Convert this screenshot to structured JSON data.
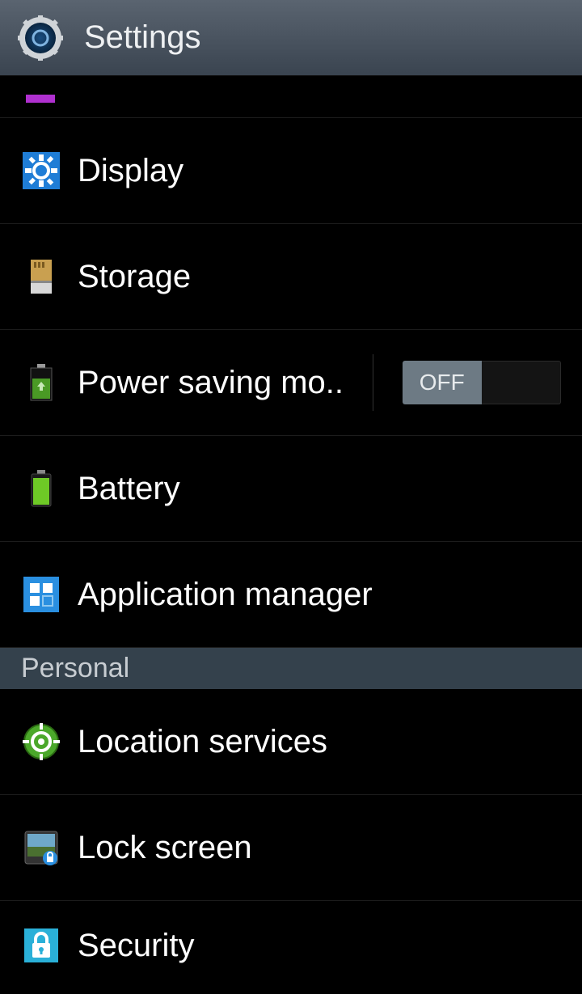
{
  "header": {
    "title": "Settings"
  },
  "items": [
    {
      "label": "Display",
      "icon": "display-cog-icon"
    },
    {
      "label": "Storage",
      "icon": "sd-card-icon"
    },
    {
      "label": "Power saving mo..",
      "icon": "battery-recycle-icon",
      "toggle": "OFF"
    },
    {
      "label": "Battery",
      "icon": "battery-icon"
    },
    {
      "label": "Application manager",
      "icon": "apps-grid-icon"
    }
  ],
  "section": "Personal",
  "personal_items": [
    {
      "label": "Location services",
      "icon": "location-target-icon"
    },
    {
      "label": "Lock screen",
      "icon": "lock-screen-icon"
    },
    {
      "label": "Security",
      "icon": "lock-icon"
    }
  ]
}
